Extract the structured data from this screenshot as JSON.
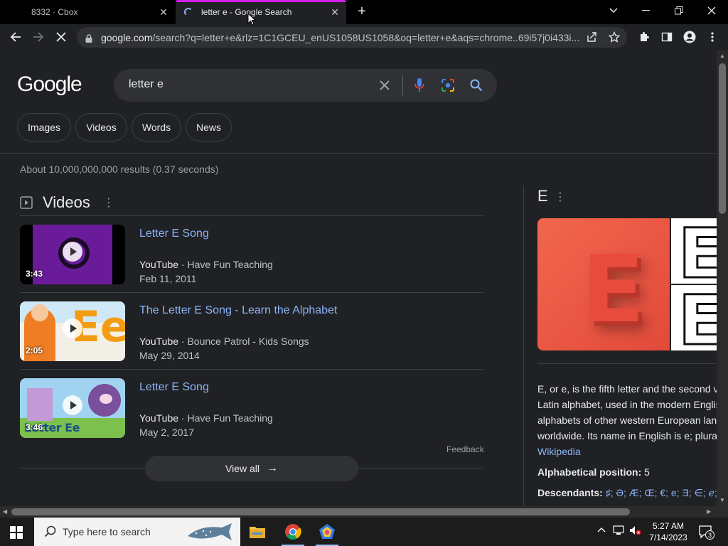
{
  "tabs": [
    {
      "title": "8332 · Cbox",
      "close": "✕"
    },
    {
      "title": "letter e - Google Search",
      "close": "✕"
    }
  ],
  "new_tab": "+",
  "address": {
    "host": "google.com",
    "path": "/search?q=letter+e&rlz=1C1GCEU_enUS1058US1058&oq=letter+e&aqs=chrome..69i57j0i433i..."
  },
  "search": {
    "logo": "Google",
    "query": "letter e"
  },
  "filters": [
    "Images",
    "Videos",
    "Words",
    "News"
  ],
  "result_stats": "About 10,000,000,000 results (0.37 seconds)",
  "videos": {
    "heading": "Videos",
    "items": [
      {
        "title": "Letter E Song",
        "source": "YouTube",
        "channel": "Have Fun Teaching",
        "date": "Feb 11, 2011",
        "duration": "3:43"
      },
      {
        "title": "The Letter E Song - Learn the Alphabet",
        "source": "YouTube",
        "channel": "Bounce Patrol - Kids Songs",
        "date": "May 29, 2014",
        "duration": "2:05"
      },
      {
        "title": "Letter E Song",
        "source": "YouTube",
        "channel": "Have Fun Teaching",
        "date": "May 2, 2017",
        "duration": "3:46"
      }
    ],
    "feedback": "Feedback",
    "view_all": "View all"
  },
  "knowledge_panel": {
    "title": "E",
    "description_lines": [
      "E, or e, is the fifth letter and the second v",
      "Latin alphabet, used in the modern Englis",
      "alphabets of other western European lan",
      "worldwide. Its name in English is e; plura"
    ],
    "source_link": "Wikipedia",
    "alphabetical_position_label": "Alphabetical position:",
    "alphabetical_position_value": "5",
    "descendants_label": "Descendants:",
    "descendants_value": "♯; Ə; Æ; Œ; €; e; Ǝ; ∈; ℯ; Ɛ; ℰ"
  },
  "taskbar": {
    "search_placeholder": "Type here to search",
    "time": "5:27 AM",
    "date": "7/14/2023",
    "notification_count": "3"
  },
  "colors": {
    "accent_tab": "#d31cf0",
    "link": "#8ab4f8",
    "page_bg": "#202124"
  }
}
